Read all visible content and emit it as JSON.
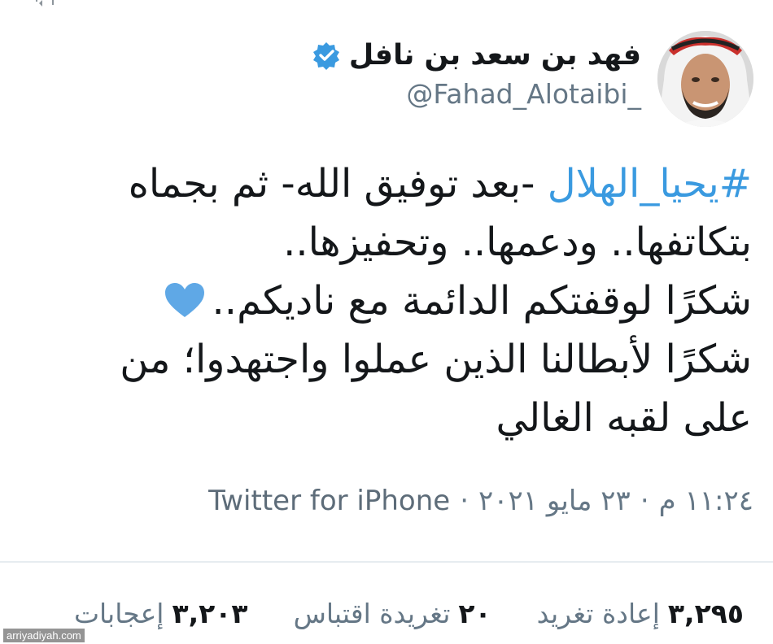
{
  "colors": {
    "accent": "#3a9ae0",
    "verified": "#3a9ae0",
    "heart": "#5fa8e6",
    "text": "#14171a",
    "muted": "#657786"
  },
  "tweet": {
    "author": {
      "display_name": "فهد بن سعد بن نافل",
      "handle": "@Fahad_Alotaibi_",
      "verified_icon": "verified-badge-icon",
      "avatar_icon": "profile-photo"
    },
    "body": {
      "hashtag": "#يحيا_الهلال",
      "line1_rest": " -بعد توفيق الله- ثم بجماه",
      "line2": "بتكاتفها.. ودعمها.. وتحفيزها..",
      "line3": "شكرًا لوقفتكم الدائمة مع ناديكم..",
      "line3_emoji": "blue-heart-icon",
      "line4": "شكرًا لأبطالنا الذين عملوا واجتهدوا؛ من",
      "line5": "على لقبه الغالي"
    },
    "meta": {
      "time": "١١:٢٤ م",
      "date": "٢٣ مايو ٢٠٢١",
      "separator": "·",
      "source": "Twitter for iPhone"
    },
    "stats": [
      {
        "value": "٣,٢٩٥",
        "label": "إعادة تغريد"
      },
      {
        "value": "٢٠",
        "label": "تغريدة اقتباس"
      },
      {
        "value": "٣,٢٠٣",
        "label": "إعجابات"
      }
    ]
  },
  "watermark": "arriyadiyah.com"
}
